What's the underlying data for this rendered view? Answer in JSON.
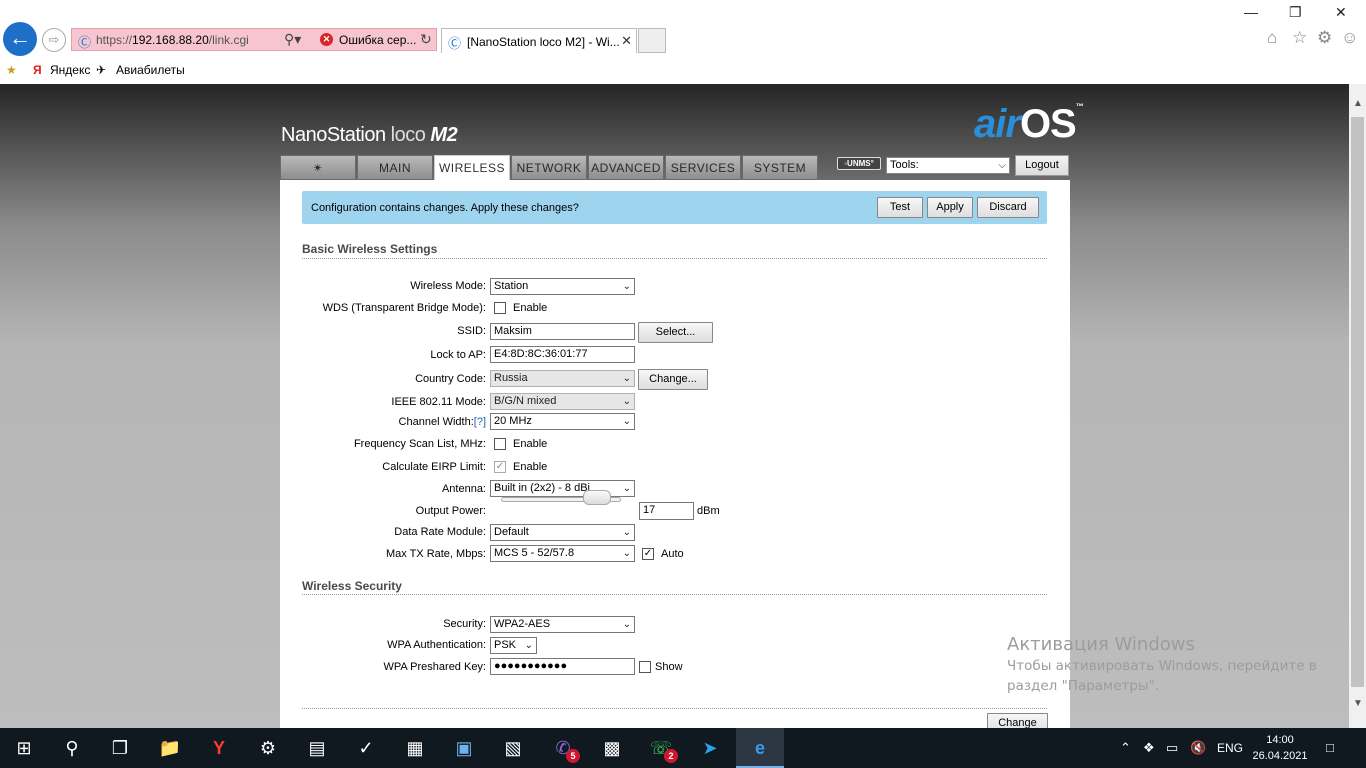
{
  "browser": {
    "address_url_prefix": "https://",
    "address_url_host": "192.168.88.20",
    "address_url_path": "/link.cgi",
    "cert_error": "Ошибка сер...",
    "tab_title": "[NanoStation loco M2] - Wi...",
    "favorites": [
      "Яндекс",
      "Авиабилеты"
    ]
  },
  "device": {
    "brand_prefix": "NanoStation",
    "brand_mid": "loco",
    "brand_suffix": "M2",
    "logo_air": "air",
    "logo_os": "OS",
    "logo_tm": "™"
  },
  "tabs": [
    {
      "label": "",
      "icon": "ubiquiti-logo-icon"
    },
    {
      "label": "MAIN"
    },
    {
      "label": "WIRELESS",
      "active": true
    },
    {
      "label": "NETWORK"
    },
    {
      "label": "ADVANCED"
    },
    {
      "label": "SERVICES"
    },
    {
      "label": "SYSTEM"
    }
  ],
  "header": {
    "unms_label": "◦UNMS°",
    "tools_value": "Tools:",
    "logout_label": "Logout"
  },
  "notice": {
    "text": "Configuration contains changes. Apply these changes?",
    "test_label": "Test",
    "apply_label": "Apply",
    "discard_label": "Discard"
  },
  "basic": {
    "title": "Basic Wireless Settings",
    "wireless_mode_label": "Wireless Mode:",
    "wireless_mode_value": "Station",
    "wds_label": "WDS (Transparent Bridge Mode):",
    "wds_checkbox_label": "Enable",
    "ssid_label": "SSID:",
    "ssid_value": "Maksim",
    "select_button": "Select...",
    "lock_label": "Lock to AP:",
    "lock_value": "E4:8D:8C:36:01:77",
    "country_label": "Country Code:",
    "country_value": "Russia",
    "change_country_button": "Change...",
    "ieee_label": "IEEE 802.11 Mode:",
    "ieee_value": "B/G/N mixed",
    "channel_width_label": "Channel Width:",
    "channel_width_help": "[?]",
    "channel_width_value": "20 MHz",
    "freq_scan_label": "Frequency Scan List, MHz:",
    "freq_scan_checkbox_label": "Enable",
    "eirp_label": "Calculate EIRP Limit:",
    "eirp_checkbox_label": "Enable",
    "eirp_checked": true,
    "antenna_label": "Antenna:",
    "antenna_value": "Built in (2x2) - 8 dBi",
    "output_power_label": "Output Power:",
    "output_power_value": "17",
    "output_power_unit": "dBm",
    "output_power_level": 0.8,
    "data_rate_label": "Data Rate Module:",
    "data_rate_value": "Default",
    "max_tx_label": "Max TX Rate, Mbps:",
    "max_tx_value": "MCS 5 - 52/57.8",
    "auto_label": "Auto",
    "auto_checked": true
  },
  "security": {
    "title": "Wireless Security",
    "security_label": "Security:",
    "security_value": "WPA2-AES",
    "wpa_auth_label": "WPA Authentication:",
    "wpa_auth_value": "PSK",
    "psk_label": "WPA Preshared Key:",
    "psk_value": "●●●●●●●●●●●",
    "show_label": "Show"
  },
  "footer": {
    "change_label": "Change"
  },
  "watermark": {
    "title": "Активация Windows",
    "line1": "Чтобы активировать Windows, перейдите в",
    "line2": "раздел \"Параметры\"."
  },
  "taskbar": {
    "viber_badge": "5",
    "whatsapp_badge": "2",
    "lang": "ENG",
    "time": "14:00",
    "date": "26.04.2021"
  }
}
